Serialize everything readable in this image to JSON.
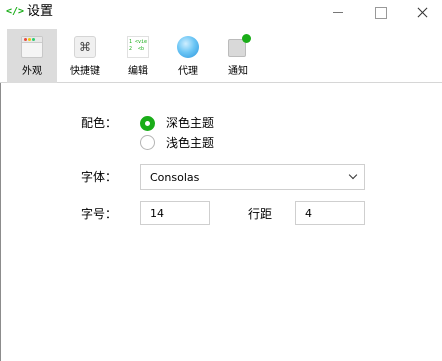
{
  "window": {
    "app_icon": "</>",
    "title": "设置"
  },
  "toolbar": {
    "items": [
      {
        "label": "外观",
        "icon": "appearance-icon",
        "active": true
      },
      {
        "label": "快捷键",
        "icon": "shortcut-icon",
        "glyph": "⌘"
      },
      {
        "label": "编辑",
        "icon": "editor-icon",
        "code_lines": [
          "1 <vie",
          "2  <b"
        ]
      },
      {
        "label": "代理",
        "icon": "proxy-icon"
      },
      {
        "label": "通知",
        "icon": "notification-icon"
      }
    ]
  },
  "settings": {
    "color_scheme": {
      "label": "配色：",
      "options": [
        {
          "label": "深色主题",
          "selected": true
        },
        {
          "label": "浅色主题",
          "selected": false
        }
      ]
    },
    "font": {
      "label": "字体：",
      "value": "Consolas"
    },
    "font_size": {
      "label": "字号：",
      "value": "14"
    },
    "line_spacing": {
      "label": "行距",
      "value": "4"
    }
  },
  "colors": {
    "accent": "#1aad19",
    "active_tab_bg": "#dcdcdc",
    "border": "#cfcfcf"
  }
}
